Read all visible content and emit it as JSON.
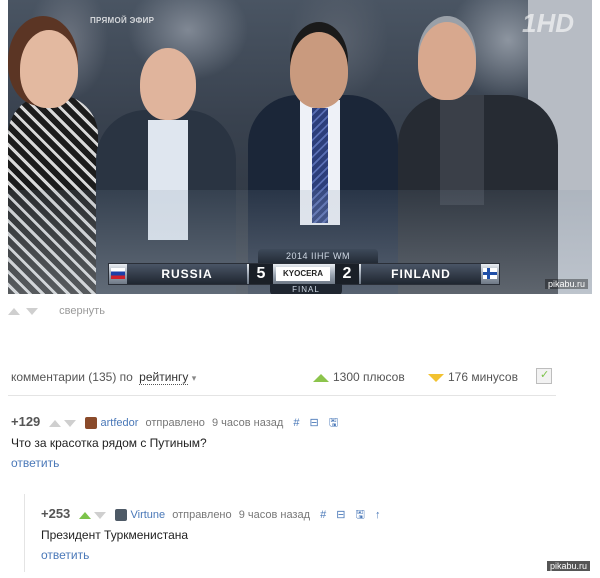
{
  "video": {
    "broadcast_label": "ПРЯМОЙ ЭФИР",
    "channel_logo": "1HD",
    "tournament": "2014 IIHF WM",
    "team_left": "RUSSIA",
    "score_left": "5",
    "sponsor": "KYOCERA",
    "score_right": "2",
    "team_right": "FINLAND",
    "stage": "FINAL",
    "watermark": "pikabu.ru"
  },
  "post_controls": {
    "collapse_label": "свернуть"
  },
  "comments_header": {
    "prefix": "комментарии (135) по",
    "sort_label": "рейтингу",
    "sort_arrow": "▾",
    "pluses": "1300 плюсов",
    "minuses": "176 минусов"
  },
  "comments": [
    {
      "rating": "+129",
      "author": "artfedor",
      "posted_label": "отправлено",
      "time": "9 часов назад",
      "text": "Что за красотка рядом с Путиным?",
      "reply_label": "ответить",
      "icons": [
        "hash-icon",
        "collapse-icon",
        "save-icon"
      ]
    },
    {
      "rating": "+253",
      "author": "Virtune",
      "posted_label": "отправлено",
      "time": "9 часов назад",
      "text": "Президент Туркменистана",
      "reply_label": "ответить",
      "icons": [
        "hash-icon",
        "collapse-icon",
        "save-icon",
        "parent-arrow-icon"
      ]
    }
  ],
  "footer": {
    "watermark": "pikabu.ru"
  },
  "colors": {
    "link": "#4a78b8",
    "plus": "#8cc44c",
    "minus": "#f2c230"
  }
}
